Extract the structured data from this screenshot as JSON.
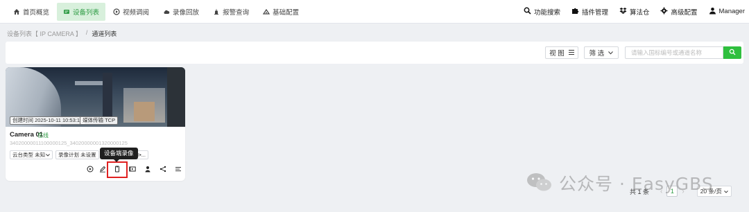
{
  "nav": {
    "items": [
      {
        "label": "首页概览",
        "icon": "home-icon",
        "active": false
      },
      {
        "label": "设备列表",
        "icon": "device-list-icon",
        "active": true
      },
      {
        "label": "视频调阅",
        "icon": "play-circle-icon",
        "active": false
      },
      {
        "label": "录像回放",
        "icon": "cloud-icon",
        "active": false
      },
      {
        "label": "报警查询",
        "icon": "alarm-icon",
        "active": false
      },
      {
        "label": "基础配置",
        "icon": "settings-icon",
        "active": false
      }
    ],
    "right": [
      {
        "label": "功能搜索",
        "icon": "search-icon"
      },
      {
        "label": "插件管理",
        "icon": "puzzle-icon"
      },
      {
        "label": "算法仓",
        "icon": "dropbox-icon"
      },
      {
        "label": "高级配置",
        "icon": "gear-icon"
      },
      {
        "label": "Manager",
        "icon": "user-icon"
      }
    ],
    "accent": "#2e9b44",
    "active_bg": "#d8f0dc"
  },
  "breadcrumb": {
    "parent": "设备列表【 IP CAMERA 】",
    "separator": "/",
    "current": "通道列表"
  },
  "filter": {
    "view_label": "视 图",
    "filter_label": "筛 选",
    "search_placeholder": "请输入国标编号或通道名称",
    "search_button_color": "#2fbf3e"
  },
  "card": {
    "created_tag": "创建时间 2025-10-11 10:53:11",
    "transport_tag": "媒体传输 TCP",
    "name": "Camera 01",
    "status": "在线",
    "id": "34020000011100000125_34020000001320000125",
    "ptz_label": "云台类型 未知",
    "record_label": "录像计划 未设置",
    "ai_label": "AI•..."
  },
  "tooltip": "设备端录像",
  "actions": [
    "play-icon",
    "edit-icon",
    "device-record-icon",
    "video-icon",
    "person-icon",
    "share-icon",
    "list-icon"
  ],
  "pagination": {
    "total": "共 1 条",
    "prev": "‹",
    "page": "1",
    "next": "›",
    "page_size": "20 条/页"
  },
  "watermark": {
    "text": "公众号 · EasyGBS"
  }
}
